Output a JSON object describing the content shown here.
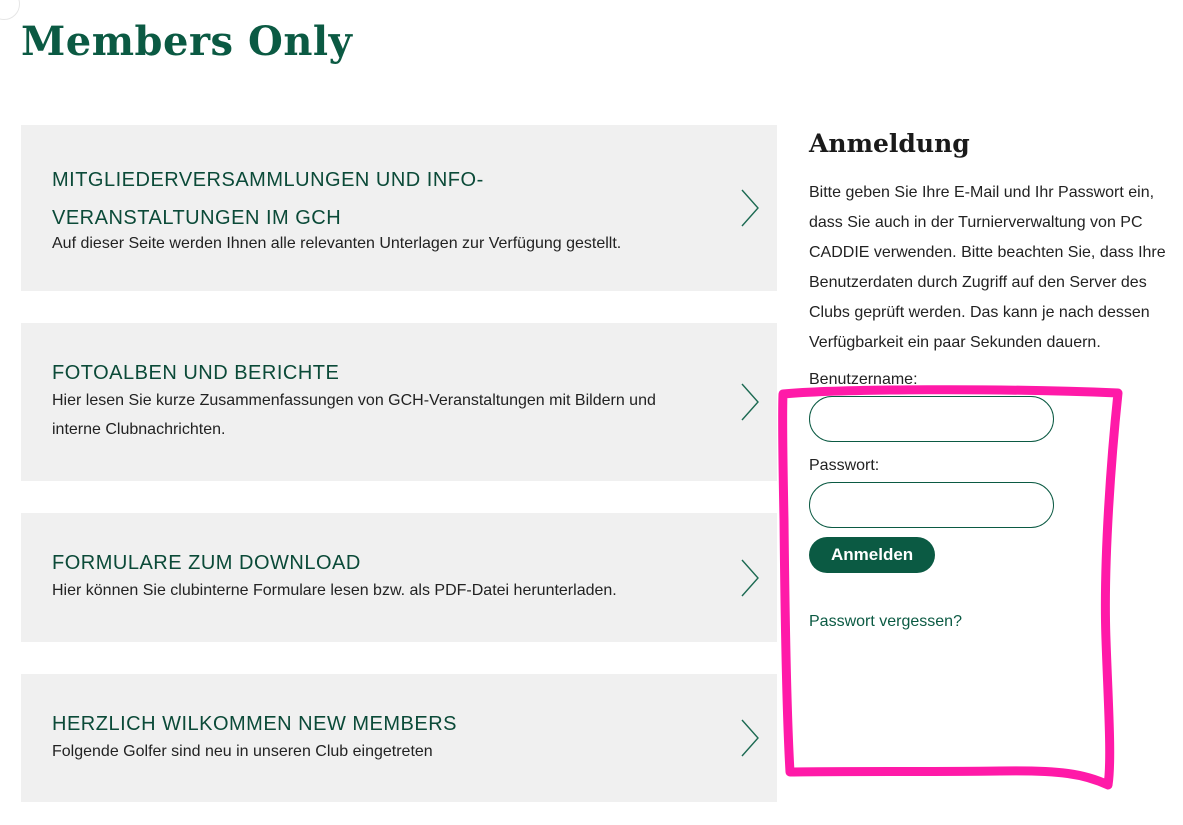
{
  "page": {
    "title": "Members Only"
  },
  "cards": [
    {
      "title": "MITGLIEDERVERSAMMLUNGEN UND INFO-VERANSTALTUNGEN IM GCH",
      "description": "Auf dieser Seite werden Ihnen alle relevanten Unterlagen zur Verfügung gestellt.",
      "icon": "chevron-right-icon"
    },
    {
      "title": "FOTOALBEN UND BERICHTE",
      "description": "Hier lesen Sie kurze Zusammenfassungen von GCH-Veranstaltungen mit Bildern und interne Clubnachrichten.",
      "icon": "chevron-right-icon"
    },
    {
      "title": "FORMULARE ZUM DOWNLOAD",
      "description": "Hier können Sie clubinterne Formulare lesen bzw.  als PDF-Datei herunterladen.",
      "icon": "chevron-right-icon"
    },
    {
      "title": "HERZLICH WILKOMMEN NEW MEMBERS",
      "description": "Folgende Golfer sind neu in unseren Club eingetreten",
      "icon": "chevron-right-icon"
    }
  ],
  "login": {
    "title": "Anmeldung",
    "intro": "Bitte geben Sie Ihre E-Mail und Ihr Passwort ein, dass Sie auch in der Turnierverwaltung von PC CADDIE verwenden. Bitte beachten Sie, dass Ihre Benutzerdaten durch Zugriff auf den Server des Clubs geprüft werden. Das kann je nach dessen Verfügbarkeit ein paar Sekunden dauern.",
    "username_label": "Benutzername:",
    "username_value": "",
    "password_label": "Passwort:",
    "password_value": "",
    "submit_label": "Anmelden",
    "forgot_label": "Passwort vergessen?"
  },
  "colors": {
    "brand_green": "#0b5a43",
    "card_background": "#f0f0f0",
    "highlight_annotation": "#ff1aa8"
  }
}
